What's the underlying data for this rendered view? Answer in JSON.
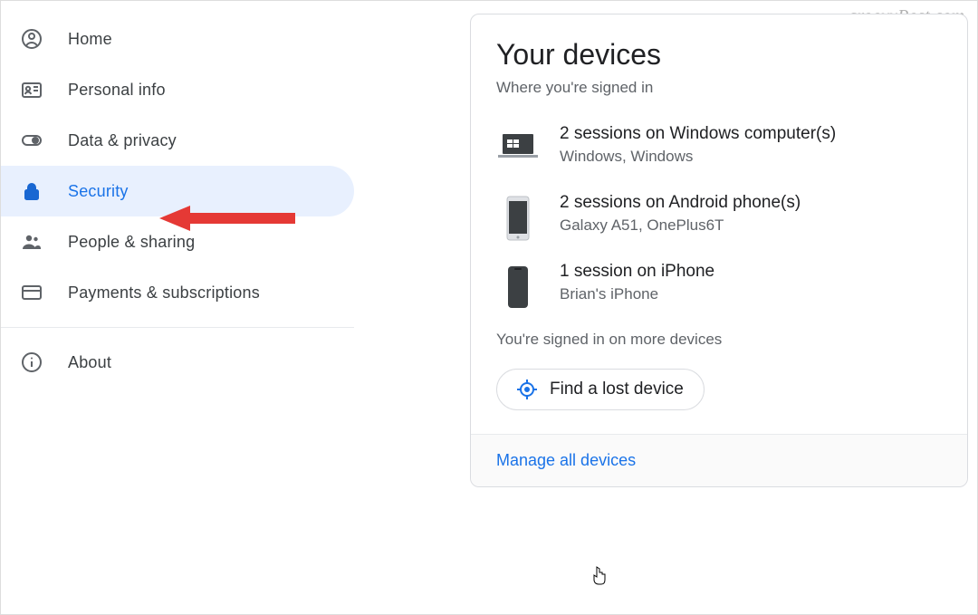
{
  "watermark": "groovyPost.com",
  "sidebar": {
    "items": [
      {
        "label": "Home"
      },
      {
        "label": "Personal info"
      },
      {
        "label": "Data & privacy"
      },
      {
        "label": "Security"
      },
      {
        "label": "People & sharing"
      },
      {
        "label": "Payments & subscriptions"
      },
      {
        "label": "About"
      }
    ]
  },
  "card": {
    "title": "Your devices",
    "subtitle": "Where you're signed in",
    "devices": [
      {
        "title": "2 sessions on Windows computer(s)",
        "sub": "Windows, Windows"
      },
      {
        "title": "2 sessions on Android phone(s)",
        "sub": "Galaxy A51, OnePlus6T"
      },
      {
        "title": "1 session on iPhone",
        "sub": "Brian's iPhone"
      }
    ],
    "more": "You're signed in on more devices",
    "find": "Find a lost device",
    "manage": "Manage all devices"
  }
}
